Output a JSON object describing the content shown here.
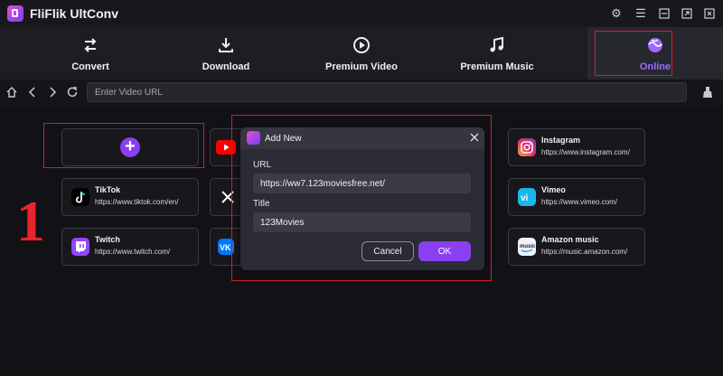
{
  "app": {
    "title": "FliFlik UltConv"
  },
  "nav": {
    "items": [
      {
        "label": "Convert",
        "icon": "convert-icon"
      },
      {
        "label": "Download",
        "icon": "download-icon"
      },
      {
        "label": "Premium Video",
        "icon": "play-circle-icon"
      },
      {
        "label": "Premium Music",
        "icon": "music-note-icon"
      },
      {
        "label": "Online",
        "icon": "online-globe-icon",
        "active": true
      }
    ]
  },
  "address_bar": {
    "placeholder": "Enter Video URL"
  },
  "sites": [
    {
      "name": "",
      "url": "",
      "icon": "youtube-icon",
      "color": "#ff0000"
    },
    {
      "name": "Instagram",
      "url": "https://www.instagram.com/",
      "icon": "instagram-icon"
    },
    {
      "name": "TikTok",
      "url": "https://www.tiktok.com/en/",
      "icon": "tiktok-icon"
    },
    {
      "name": "",
      "url": "",
      "icon": "x-icon"
    },
    {
      "name": "Vimeo",
      "url": "https://www.vimeo.com/",
      "icon": "vimeo-icon",
      "color": "#1ab7ea"
    },
    {
      "name": "Twitch",
      "url": "https://www.twitch.com/",
      "icon": "twitch-icon",
      "color": "#9146ff"
    },
    {
      "name": "",
      "url": "",
      "icon": "vk-icon",
      "color": "#0077ff"
    },
    {
      "name": "Amazon music",
      "url": "https://music.amazon.com/",
      "icon": "amazon-music-icon"
    }
  ],
  "annotation": {
    "step": "1"
  },
  "dialog": {
    "title": "Add New",
    "url_label": "URL",
    "url_value": "https://ww7.123moviesfree.net/",
    "title_label": "Title",
    "title_value": "123Movies",
    "cancel_label": "Cancel",
    "ok_label": "OK"
  },
  "colors": {
    "accent": "#8a3ff0",
    "highlight": "#d21f2a",
    "background": "#121216"
  }
}
